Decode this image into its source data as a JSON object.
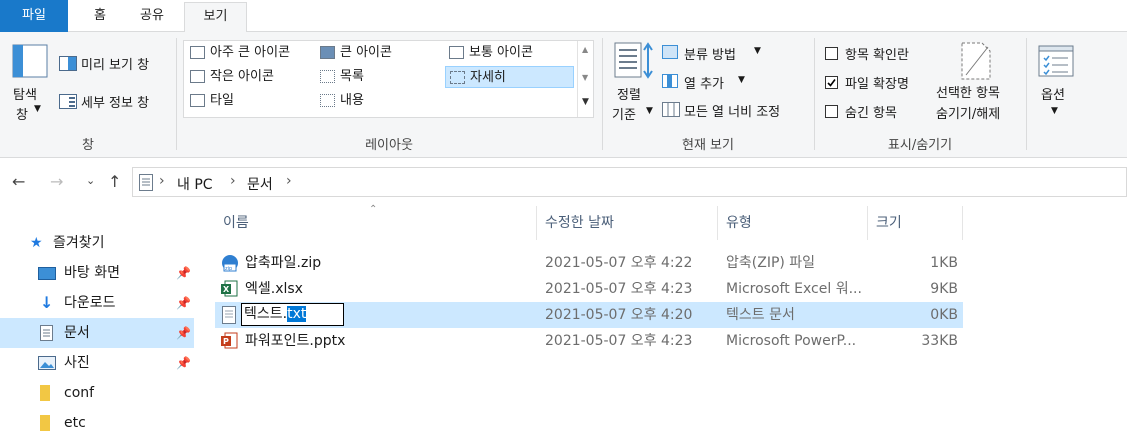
{
  "tabs": {
    "file": "파일",
    "home": "홈",
    "share": "공유",
    "view": "보기"
  },
  "ribbon": {
    "pane": {
      "nav_pane_line1": "탐색",
      "nav_pane_line2": "창",
      "preview": "미리 보기 창",
      "details": "세부 정보 창",
      "label": "창"
    },
    "layout": {
      "items": [
        "아주 큰 아이콘",
        "큰 아이콘",
        "보통 아이콘",
        "작은 아이콘",
        "목록",
        "자세히",
        "타일",
        "내용"
      ],
      "selected": "자세히",
      "label": "레이아웃"
    },
    "current_view": {
      "sort_line1": "정렬",
      "sort_line2": "기준",
      "group_by": "분류 방법",
      "add_columns": "열 추가",
      "fit_columns": "모든 열 너비 조정",
      "label": "현재 보기"
    },
    "show_hide": {
      "item_checkboxes": "항목 확인란",
      "item_checkboxes_checked": false,
      "file_extensions": "파일 확장명",
      "file_extensions_checked": true,
      "hidden_items": "숨긴 항목",
      "hidden_items_checked": false,
      "hide_selected_line1": "선택한 항목",
      "hide_selected_line2": "숨기기/해제",
      "label": "표시/숨기기"
    },
    "options": "옵션"
  },
  "address": {
    "crumbs": [
      "내 PC",
      "문서"
    ]
  },
  "sidebar": {
    "items": [
      {
        "label": "즐겨찾기",
        "icon": "star-icon"
      },
      {
        "label": "바탕 화면",
        "icon": "desktop-icon",
        "pinned": true
      },
      {
        "label": "다운로드",
        "icon": "download-icon",
        "pinned": true
      },
      {
        "label": "문서",
        "icon": "document-icon",
        "pinned": true,
        "selected": true
      },
      {
        "label": "사진",
        "icon": "pictures-icon",
        "pinned": true
      },
      {
        "label": "conf",
        "icon": "folder-icon"
      },
      {
        "label": "etc",
        "icon": "folder-icon"
      }
    ]
  },
  "columns": {
    "name": "이름",
    "modified": "수정한 날짜",
    "type": "유형",
    "size": "크기"
  },
  "files": [
    {
      "name": "압축파일.zip",
      "date": "2021-05-07 오후 4:22",
      "type": "압축(ZIP) 파일",
      "size": "1KB",
      "icon": "zip-icon"
    },
    {
      "name": "엑셀.xlsx",
      "date": "2021-05-07 오후 4:23",
      "type": "Microsoft Excel 워...",
      "size": "9KB",
      "icon": "excel-icon"
    },
    {
      "name": "텍스트.txt",
      "date": "2021-05-07 오후 4:20",
      "type": "텍스트 문서",
      "size": "0KB",
      "icon": "text-file-icon",
      "selected": true,
      "rename_base": "텍스트.",
      "rename_ext": "txt"
    },
    {
      "name": "파워포인트.pptx",
      "date": "2021-05-07 오후 4:23",
      "type": "Microsoft PowerP...",
      "size": "33KB",
      "icon": "powerpoint-icon"
    }
  ],
  "colors": {
    "accent": "#1979ca",
    "selection": "#cce8ff",
    "rename_highlight": "#0078d7"
  }
}
